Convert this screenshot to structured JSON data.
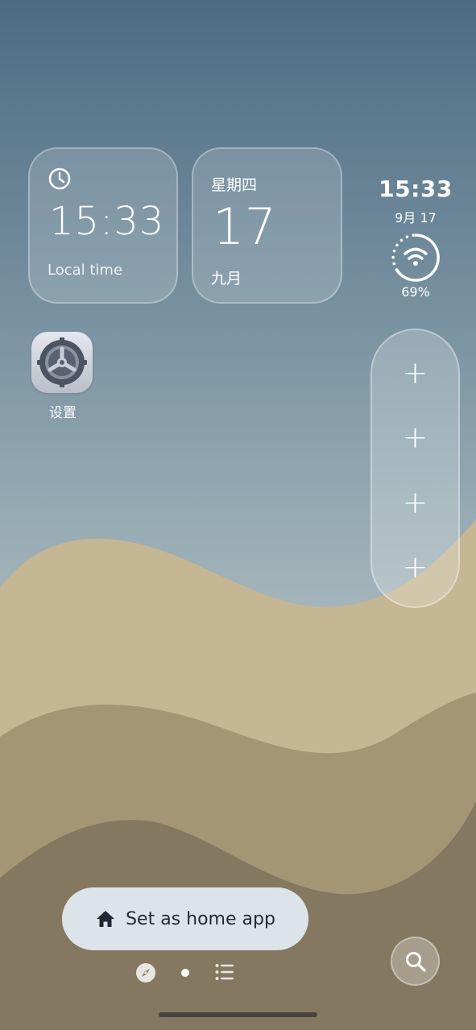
{
  "clock_widget": {
    "time": "15:33",
    "label": "Local time"
  },
  "date_widget": {
    "weekday": "星期四",
    "day": "17",
    "month": "九月"
  },
  "status": {
    "time": "15:33",
    "date": "9月 17",
    "battery": "69%"
  },
  "apps": [
    {
      "label": "设置",
      "icon": "settings-gear-icon"
    }
  ],
  "shortcuts": {
    "items": [
      "+",
      "+",
      "+",
      "+"
    ]
  },
  "home_button": {
    "label": "Set as home app",
    "icon": "home-icon"
  },
  "page_indicators": [
    "compass-icon",
    "current-page-dot",
    "list-icon"
  ],
  "search": {
    "icon": "search-icon"
  },
  "colors": {
    "sky_top": "#4f6b82",
    "sand_light": "#c5b793",
    "sand_mid": "#a49675",
    "sand_dark": "#857860",
    "button_bg": "#dce4ea"
  }
}
